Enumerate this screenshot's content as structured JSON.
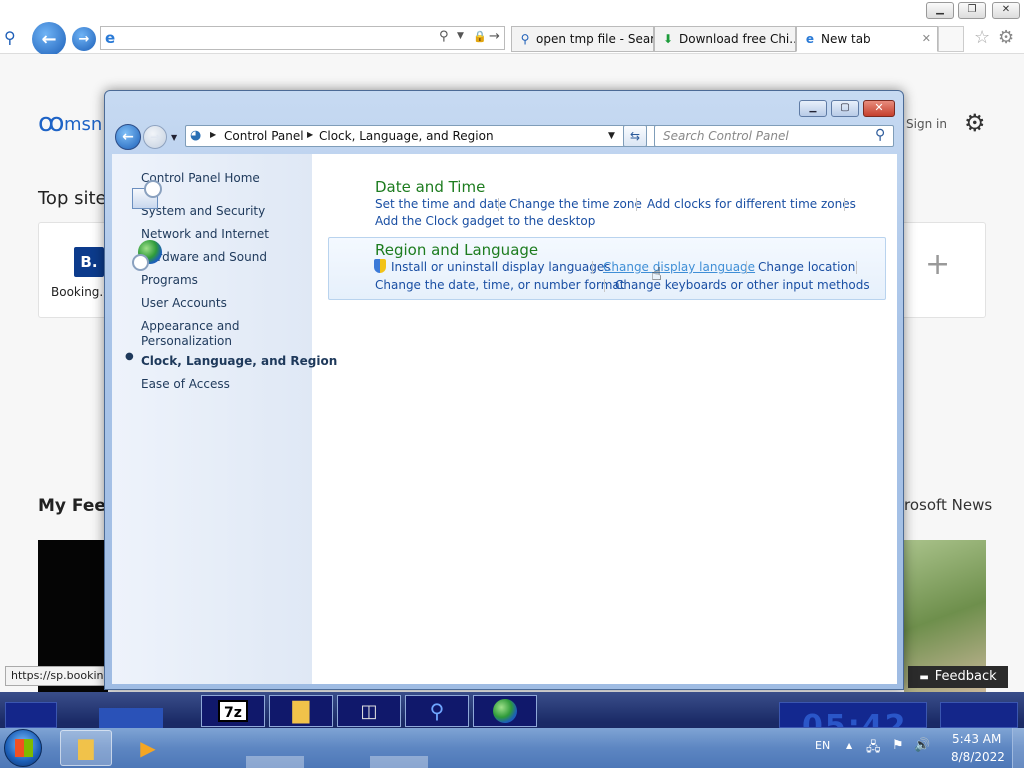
{
  "browser": {
    "address_value": "",
    "tabs": [
      {
        "label": "open tmp file - Sear...",
        "icon": "search-icon"
      },
      {
        "label": "Download free Chi...",
        "icon": "download-icon"
      },
      {
        "label": "New tab",
        "icon": "ie-icon"
      }
    ],
    "tab_close": "✕",
    "status_url": "https://sp.bookin"
  },
  "msn": {
    "logo_text": "msn",
    "sign_in": "Sign in",
    "top_sites": "Top sites",
    "booking_label": "Booking.c",
    "booking_letter": "B.",
    "plus": "+",
    "my_feed": "My Feed",
    "microsoft_news": "rosoft News",
    "feedback": "Feedback"
  },
  "control_panel": {
    "breadcrumb": [
      "Control Panel",
      "Clock, Language, and Region"
    ],
    "search_placeholder": "Search Control Panel",
    "nav": {
      "home": "Control Panel Home",
      "items": [
        "System and Security",
        "Network and Internet",
        "Hardware and Sound",
        "Programs",
        "User Accounts",
        "Appearance and",
        "Personalization",
        "Clock, Language, and Region",
        "Ease of Access"
      ]
    },
    "date_time": {
      "title": "Date and Time",
      "links": [
        "Set the time and date",
        "Change the time zone",
        "Add clocks for different time zones",
        "Add the Clock gadget to the desktop"
      ]
    },
    "region_language": {
      "title": "Region and Language",
      "links": [
        "Install or uninstall display languages",
        "Change display language",
        "Change location",
        "Change the date, time, or number format",
        "Change keyboards or other input methods"
      ]
    }
  },
  "taskbar": {
    "switcher_7z": "7z",
    "clock_big": "05:42",
    "lang": "EN",
    "time": "5:43 AM",
    "date": "8/8/2022"
  }
}
